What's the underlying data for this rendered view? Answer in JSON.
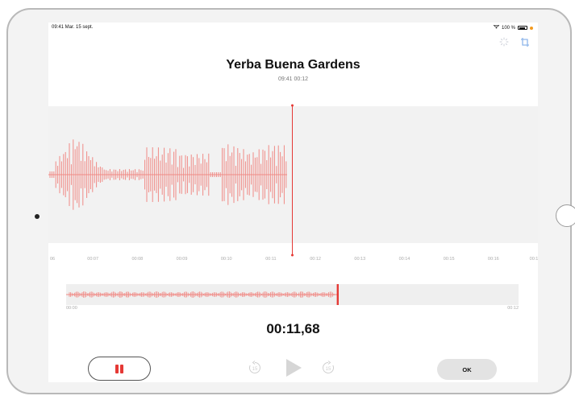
{
  "status_bar": {
    "time_date": "09:41  Mar. 15 sept.",
    "battery": "100 %"
  },
  "icons": {
    "wifi": "wifi-icon",
    "enhance": "magic-wand-icon",
    "trim": "crop-icon",
    "skip_back": "skip-back-15-icon",
    "play": "play-icon",
    "skip_forward": "skip-forward-15-icon",
    "pause": "pause-icon"
  },
  "recording": {
    "title": "Yerba Buena Gardens",
    "subtitle": "09:41  00:12",
    "elapsed": "00:11,68"
  },
  "timeline": {
    "ticks": [
      "06",
      "00:07",
      "00:08",
      "00:09",
      "00:10",
      "00:11",
      "00:12",
      "00:13",
      "00:14",
      "00:15",
      "00:16",
      "00:1"
    ]
  },
  "overview": {
    "start_label": "00:00",
    "end_label": "00:12",
    "progress": 0.6
  },
  "controls": {
    "skip_back_label": "15",
    "skip_forward_label": "15",
    "ok_label": "OK"
  },
  "colors": {
    "waveform": "#f08a85",
    "accent": "#e53935",
    "play_disabled": "#d6d6d6"
  }
}
